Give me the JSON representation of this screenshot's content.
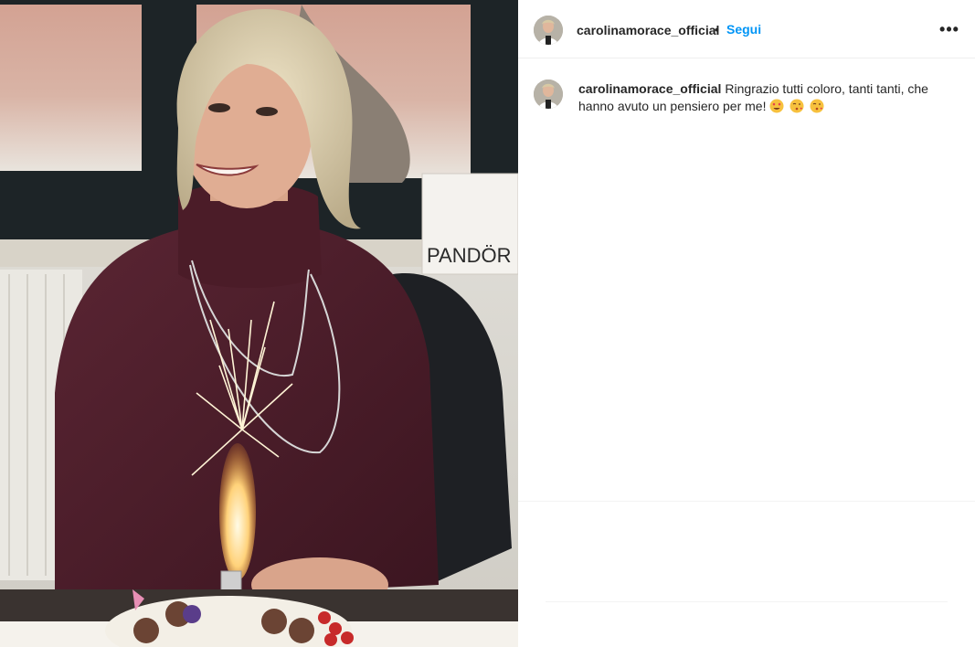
{
  "post": {
    "username": "carolinamorace_official",
    "separator": "•",
    "follow_label": "Segui",
    "more_label": "•••",
    "caption": {
      "username": "carolinamorace_official",
      "text": "Ringrazio tutti coloro, tanti tanti, che hanno avuto un pensiero per me!",
      "emojis": [
        "smiling-face-with-heart-eyes",
        "face-blowing-kiss",
        "face-blowing-kiss"
      ]
    },
    "photo": {
      "description_icon": "birthday-photo",
      "shopping_bag_text": "PANDÖR"
    }
  },
  "colors": {
    "link": "#0095f6",
    "text": "#262626",
    "divider": "#efefef"
  }
}
